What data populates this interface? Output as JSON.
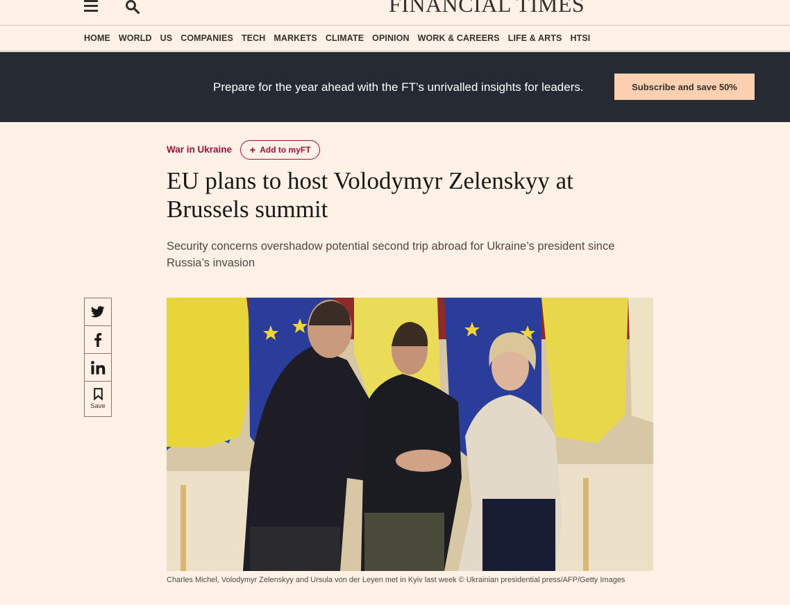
{
  "header": {
    "masthead": "FINANCIAL TIMES",
    "menu_icon": "hamburger-menu-icon",
    "search_icon": "search-icon"
  },
  "nav": {
    "items": [
      "HOME",
      "WORLD",
      "US",
      "COMPANIES",
      "TECH",
      "MARKETS",
      "CLIMATE",
      "OPINION",
      "WORK & CAREERS",
      "LIFE & ARTS",
      "HTSI"
    ]
  },
  "promo": {
    "text": "Prepare for the year ahead with the FT’s unrivalled insights for leaders.",
    "button_label": "Subscribe and save 50%"
  },
  "article": {
    "topic": "War in Ukraine",
    "add_myft_label": "Add to myFT",
    "headline": "EU plans to host Volodymyr Zelenskyy at Brussels summit",
    "standfirst": "Security concerns overshadow potential second trip abroad for Ukraine’s president since Russia’s invasion",
    "caption": "Charles Michel, Volodymyr Zelenskyy and Ursula von der Leyen met in Kyiv last week © Ukrainian presidential press/AFP/Getty Images"
  },
  "share": {
    "buttons": [
      "twitter-icon",
      "facebook-icon",
      "linkedin-icon",
      "bookmark-icon"
    ],
    "save_label": "Save"
  },
  "colors": {
    "page_bg": "#fff1e5",
    "promo_bg": "#262a33",
    "promo_button": "#fcd0b1",
    "claret": "#990f3d"
  }
}
